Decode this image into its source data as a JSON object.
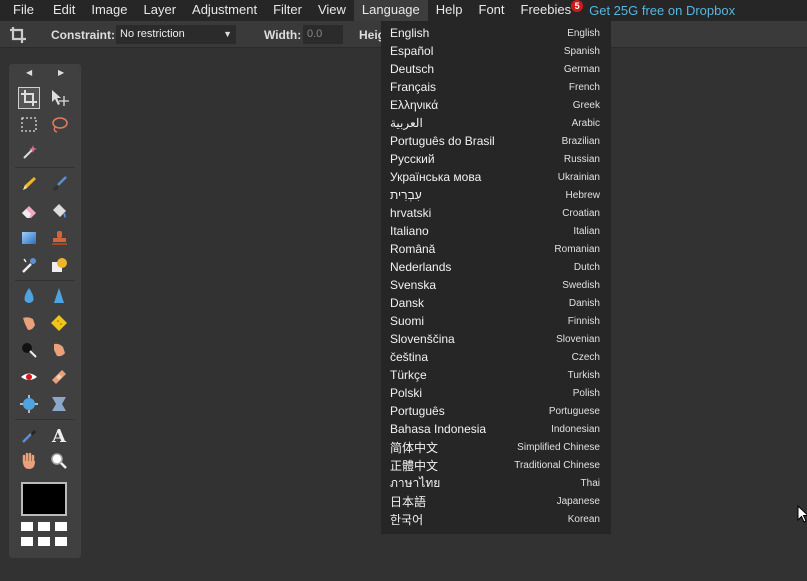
{
  "menubar": {
    "items": [
      "File",
      "Edit",
      "Image",
      "Layer",
      "Adjustment",
      "Filter",
      "View",
      "Language",
      "Help",
      "Font",
      "Freebies"
    ],
    "freebies_badge": "5",
    "promo": "Get 25G free on Dropbox"
  },
  "options": {
    "constraint_label": "Constraint:",
    "constraint_value": "No restriction",
    "width_label": "Width:",
    "width_value": "0.0",
    "height_label": "Heig"
  },
  "tools": {
    "icons": [
      "crop-icon",
      "move-icon",
      "marquee-icon",
      "lasso-icon",
      "wand-icon",
      "pencil-icon",
      "brush-icon",
      "eraser-icon",
      "bucket-icon",
      "gradient-icon",
      "stamp-icon",
      "picker-icon",
      "shape-icon",
      "drop-icon",
      "sharpen-icon",
      "smudge-icon",
      "sponge-icon",
      "burn-icon",
      "dodge-icon",
      "redeye-icon",
      "bandage-icon",
      "bloat-icon",
      "pinch-icon",
      "colorpicker-icon",
      "type-icon",
      "hand-icon",
      "zoom-icon"
    ]
  },
  "language_menu": {
    "items": [
      {
        "native": "English",
        "english": "English"
      },
      {
        "native": "Español",
        "english": "Spanish"
      },
      {
        "native": "Deutsch",
        "english": "German"
      },
      {
        "native": "Français",
        "english": "French"
      },
      {
        "native": "Ελληνικά",
        "english": "Greek"
      },
      {
        "native": "العربية",
        "english": "Arabic"
      },
      {
        "native": "Português do Brasil",
        "english": "Brazilian"
      },
      {
        "native": "Русский",
        "english": "Russian"
      },
      {
        "native": "Українська мова",
        "english": "Ukrainian"
      },
      {
        "native": "עִבְרִית",
        "english": "Hebrew"
      },
      {
        "native": "hrvatski",
        "english": "Croatian"
      },
      {
        "native": "Italiano",
        "english": "Italian"
      },
      {
        "native": "Română",
        "english": "Romanian"
      },
      {
        "native": "Nederlands",
        "english": "Dutch"
      },
      {
        "native": "Svenska",
        "english": "Swedish"
      },
      {
        "native": "Dansk",
        "english": "Danish"
      },
      {
        "native": "Suomi",
        "english": "Finnish"
      },
      {
        "native": "Slovenščina",
        "english": "Slovenian"
      },
      {
        "native": "čeština",
        "english": "Czech"
      },
      {
        "native": "Türkçe",
        "english": "Turkish"
      },
      {
        "native": "Polski",
        "english": "Polish"
      },
      {
        "native": "Português",
        "english": "Portuguese"
      },
      {
        "native": "Bahasa Indonesia",
        "english": "Indonesian"
      },
      {
        "native": "简体中文",
        "english": "Simplified Chinese"
      },
      {
        "native": "正體中文",
        "english": "Traditional Chinese"
      },
      {
        "native": "ภาษาไทย",
        "english": "Thai"
      },
      {
        "native": "日本語",
        "english": "Japanese"
      },
      {
        "native": "한국어",
        "english": "Korean"
      }
    ]
  },
  "colors": {
    "background": "#323232",
    "menubar": "#262626",
    "promo": "#56b6e0",
    "badge": "#d0191b"
  }
}
